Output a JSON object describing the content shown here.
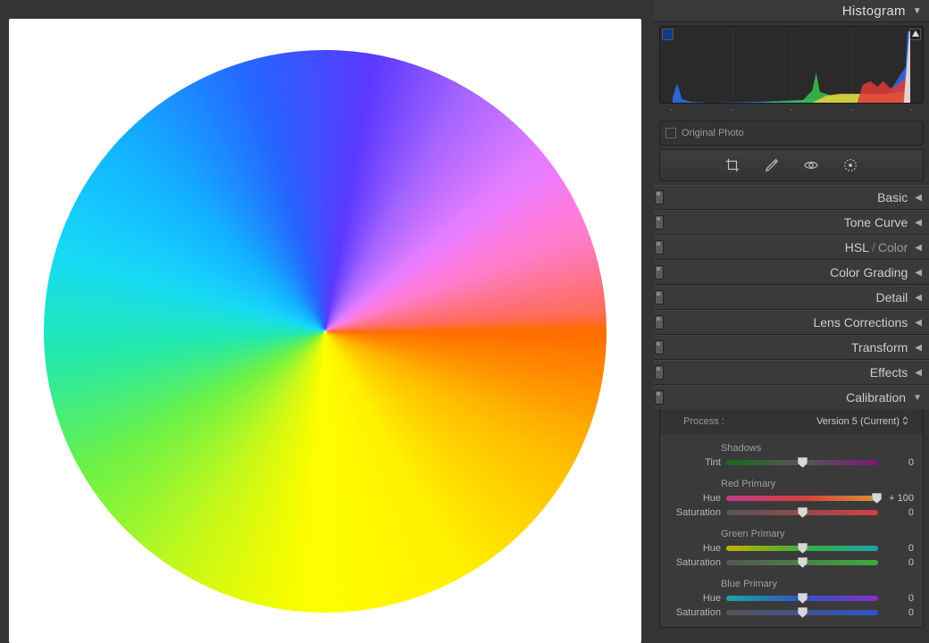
{
  "panels": {
    "histogram": {
      "title": "Histogram",
      "original_photo": "Original Photo",
      "axis": [
        "-",
        "-",
        "-",
        "-",
        "-"
      ]
    },
    "basic": "Basic",
    "tone_curve": "Tone Curve",
    "hsl": "HSL",
    "color": "Color",
    "color_grading": "Color Grading",
    "detail": "Detail",
    "lens": "Lens Corrections",
    "transform": "Transform",
    "effects": "Effects",
    "calibration": "Calibration"
  },
  "tools": [
    "crop",
    "brush",
    "eye",
    "radial"
  ],
  "calibration": {
    "process_label": "Process :",
    "process_value": "Version 5 (Current)",
    "shadows_title": "Shadows",
    "tint_label": "Tint",
    "tint_value": "0",
    "red_title": "Red Primary",
    "green_title": "Green Primary",
    "blue_title": "Blue Primary",
    "hue_label": "Hue",
    "sat_label": "Saturation",
    "red_hue": "+ 100",
    "red_sat": "0",
    "green_hue": "0",
    "green_sat": "0",
    "blue_hue": "0",
    "blue_sat": "0"
  },
  "slider_positions": {
    "tint": 50,
    "red_hue": 99,
    "red_sat": 50,
    "green_hue": 50,
    "green_sat": 50,
    "blue_hue": 50,
    "blue_sat": 50
  },
  "chart_data": {
    "type": "area",
    "title": "Histogram",
    "xlabel": "",
    "ylabel": "",
    "xlim": [
      0,
      255
    ],
    "ylim": [
      0,
      80
    ],
    "series": [
      {
        "name": "blue",
        "color": "#2e6df0",
        "points": [
          [
            0,
            6
          ],
          [
            5,
            22
          ],
          [
            10,
            4
          ],
          [
            20,
            1
          ],
          [
            40,
            0
          ],
          [
            90,
            1
          ],
          [
            160,
            4
          ],
          [
            200,
            6
          ],
          [
            230,
            8
          ],
          [
            250,
            40
          ],
          [
            252,
            80
          ],
          [
            255,
            80
          ]
        ]
      },
      {
        "name": "green",
        "color": "#3cc24a",
        "points": [
          [
            0,
            0
          ],
          [
            90,
            0
          ],
          [
            140,
            3
          ],
          [
            150,
            14
          ],
          [
            154,
            34
          ],
          [
            158,
            12
          ],
          [
            170,
            8
          ],
          [
            200,
            9
          ],
          [
            230,
            9
          ],
          [
            250,
            12
          ],
          [
            255,
            80
          ]
        ]
      },
      {
        "name": "yellow",
        "color": "#e8d23a",
        "points": [
          [
            0,
            0
          ],
          [
            150,
            0
          ],
          [
            165,
            8
          ],
          [
            180,
            10
          ],
          [
            200,
            10
          ],
          [
            230,
            10
          ],
          [
            248,
            12
          ],
          [
            255,
            40
          ]
        ]
      },
      {
        "name": "red",
        "color": "#e23a3a",
        "points": [
          [
            0,
            0
          ],
          [
            198,
            0
          ],
          [
            204,
            20
          ],
          [
            212,
            24
          ],
          [
            220,
            18
          ],
          [
            226,
            24
          ],
          [
            234,
            16
          ],
          [
            244,
            22
          ],
          [
            252,
            30
          ],
          [
            255,
            80
          ]
        ]
      },
      {
        "name": "white",
        "color": "#e8e8e8",
        "points": [
          [
            0,
            0
          ],
          [
            248,
            0
          ],
          [
            254,
            80
          ],
          [
            255,
            80
          ]
        ]
      }
    ]
  }
}
